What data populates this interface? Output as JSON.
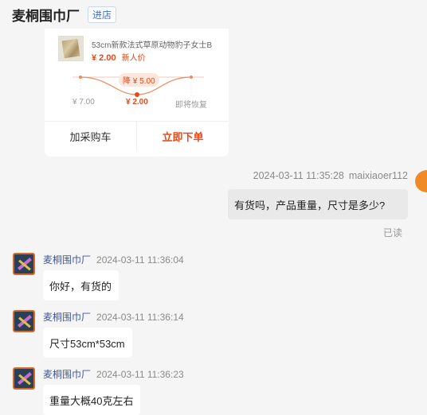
{
  "header": {
    "shop_name": "麦桐围巾厂",
    "enter_shop_label": "进店"
  },
  "product_card": {
    "title": "53cm新款法式草原动物豹子女士B",
    "price": "¥ 2.00",
    "price_tag": "新人价",
    "drop_badge": "降 ¥ 5.00",
    "graph_labels": [
      "¥ 7.00",
      "¥ 2.00",
      "即将恢复"
    ],
    "add_to_cart_label": "加采购车",
    "buy_now_label": "立即下单",
    "accent_color": "#e64a19"
  },
  "messages": {
    "outgoing": {
      "timestamp": "2024-03-11 11:35:28",
      "sender": "maixiaoer112",
      "text": "有货吗，产品重量，尺寸是多少?",
      "status": "已读"
    },
    "incoming": [
      {
        "sender": "麦桐围巾厂",
        "timestamp": "2024-03-11 11:36:04",
        "text": "你好，有货的"
      },
      {
        "sender": "麦桐围巾厂",
        "timestamp": "2024-03-11 11:36:14",
        "text": "尺寸53cm*53cm"
      },
      {
        "sender": "麦桐围巾厂",
        "timestamp": "2024-03-11 11:36:23",
        "text": "重量大概40克左右"
      }
    ]
  }
}
